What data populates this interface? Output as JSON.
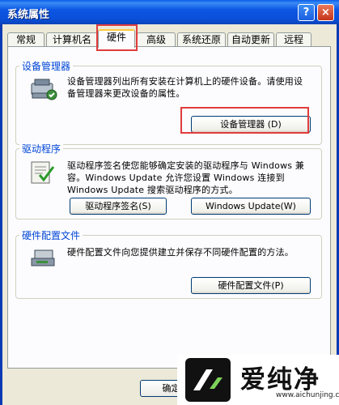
{
  "window": {
    "title": "系统属性"
  },
  "titlebar": {
    "help_label": "?",
    "close_label": "×"
  },
  "tabs": [
    {
      "label": "常规"
    },
    {
      "label": "计算机名"
    },
    {
      "label": "硬件"
    },
    {
      "label": "高级"
    },
    {
      "label": "系统还原"
    },
    {
      "label": "自动更新"
    },
    {
      "label": "远程"
    }
  ],
  "groups": {
    "device_manager": {
      "title": "设备管理器",
      "description": "设备管理器列出所有安装在计算机上的硬件设备。请使用设备管理器来更改设备的属性。",
      "button_label": "设备管理器 (D)",
      "icon": "device-manager-icon"
    },
    "drivers": {
      "title": "驱动程序",
      "description": "驱动程序签名使您能够确定安装的驱动程序与 Windows 兼容。Windows Update 允许您设置 Windows 连接到 Windows Update 搜索驱动程序的方式。",
      "signing_button_label": "驱动程序签名(S)",
      "update_button_label": "Windows Update(W)",
      "icon": "driver-signing-icon"
    },
    "hardware_profiles": {
      "title": "硬件配置文件",
      "description": "硬件配置文件向您提供建立并保存不同硬件配置的方法。",
      "button_label": "硬件配置文件(P)",
      "icon": "hardware-profile-icon"
    }
  },
  "footer": {
    "ok_label": "确定"
  },
  "watermark": {
    "logo_text": "爱纯净",
    "url": "www.aichunjing.com"
  },
  "colors": {
    "titlebar": "#0a4fd8",
    "highlight": "#e03c3c",
    "group_title": "#0046d5"
  }
}
